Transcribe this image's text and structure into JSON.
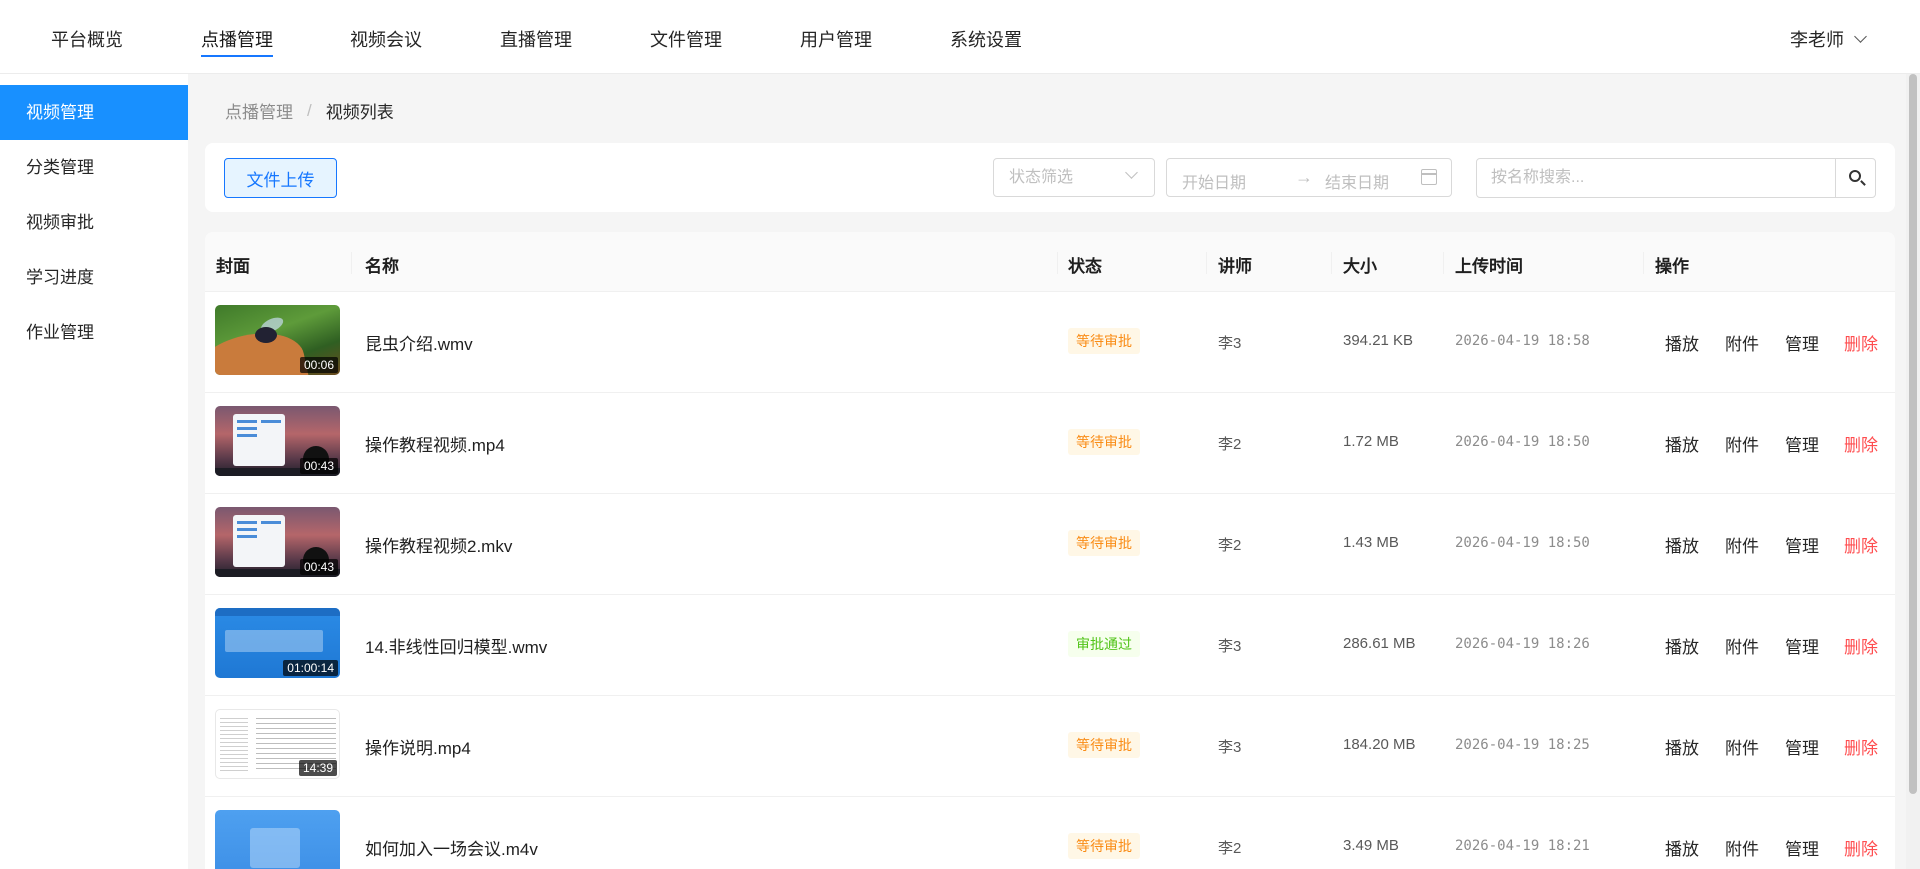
{
  "topnav": {
    "items": [
      "平台概览",
      "点播管理",
      "视频会议",
      "直播管理",
      "文件管理",
      "用户管理",
      "系统设置"
    ],
    "active_index": 1,
    "user": "李老师"
  },
  "sidebar": {
    "items": [
      "视频管理",
      "分类管理",
      "视频审批",
      "学习进度",
      "作业管理"
    ],
    "active_index": 0
  },
  "breadcrumb": {
    "parent": "点播管理",
    "separator": "/",
    "current": "视频列表"
  },
  "toolbar": {
    "upload_label": "文件上传",
    "status_placeholder": "状态筛选",
    "start_date_placeholder": "开始日期",
    "range_arrow": "→",
    "end_date_placeholder": "结束日期",
    "search_placeholder": "按名称搜索..."
  },
  "table": {
    "columns": [
      "封面",
      "名称",
      "状态",
      "讲师",
      "大小",
      "上传时间",
      "操作"
    ],
    "actions": [
      "播放",
      "附件",
      "管理",
      "删除"
    ],
    "rows": [
      {
        "duration": "00:06",
        "name": "昆虫介绍.wmv",
        "status": "等待审批",
        "teacher": "李3",
        "size": "394.21 KB",
        "time": "2026-04-19 18:58"
      },
      {
        "duration": "00:43",
        "name": "操作教程视频.mp4",
        "status": "等待审批",
        "teacher": "李2",
        "size": "1.72 MB",
        "time": "2026-04-19 18:50"
      },
      {
        "duration": "00:43",
        "name": "操作教程视频2.mkv",
        "status": "等待审批",
        "teacher": "李2",
        "size": "1.43 MB",
        "time": "2026-04-19 18:50"
      },
      {
        "duration": "01:00:14",
        "name": "14.非线性回归模型.wmv",
        "status": "审批通过",
        "teacher": "李3",
        "size": "286.61 MB",
        "time": "2026-04-19 18:26"
      },
      {
        "duration": "14:39",
        "name": "操作说明.mp4",
        "status": "等待审批",
        "teacher": "李3",
        "size": "184.20 MB",
        "time": "2026-04-19 18:25"
      },
      {
        "duration": "",
        "name": "如何加入一场会议.m4v",
        "status": "等待审批",
        "teacher": "李2",
        "size": "3.49 MB",
        "time": "2026-04-19 18:21"
      }
    ]
  },
  "colors": {
    "primary": "#1677ff",
    "sidebar_active": "#1890ff",
    "pending": "#fa8c16",
    "approved": "#52c41a",
    "danger": "#ff4d4f"
  }
}
